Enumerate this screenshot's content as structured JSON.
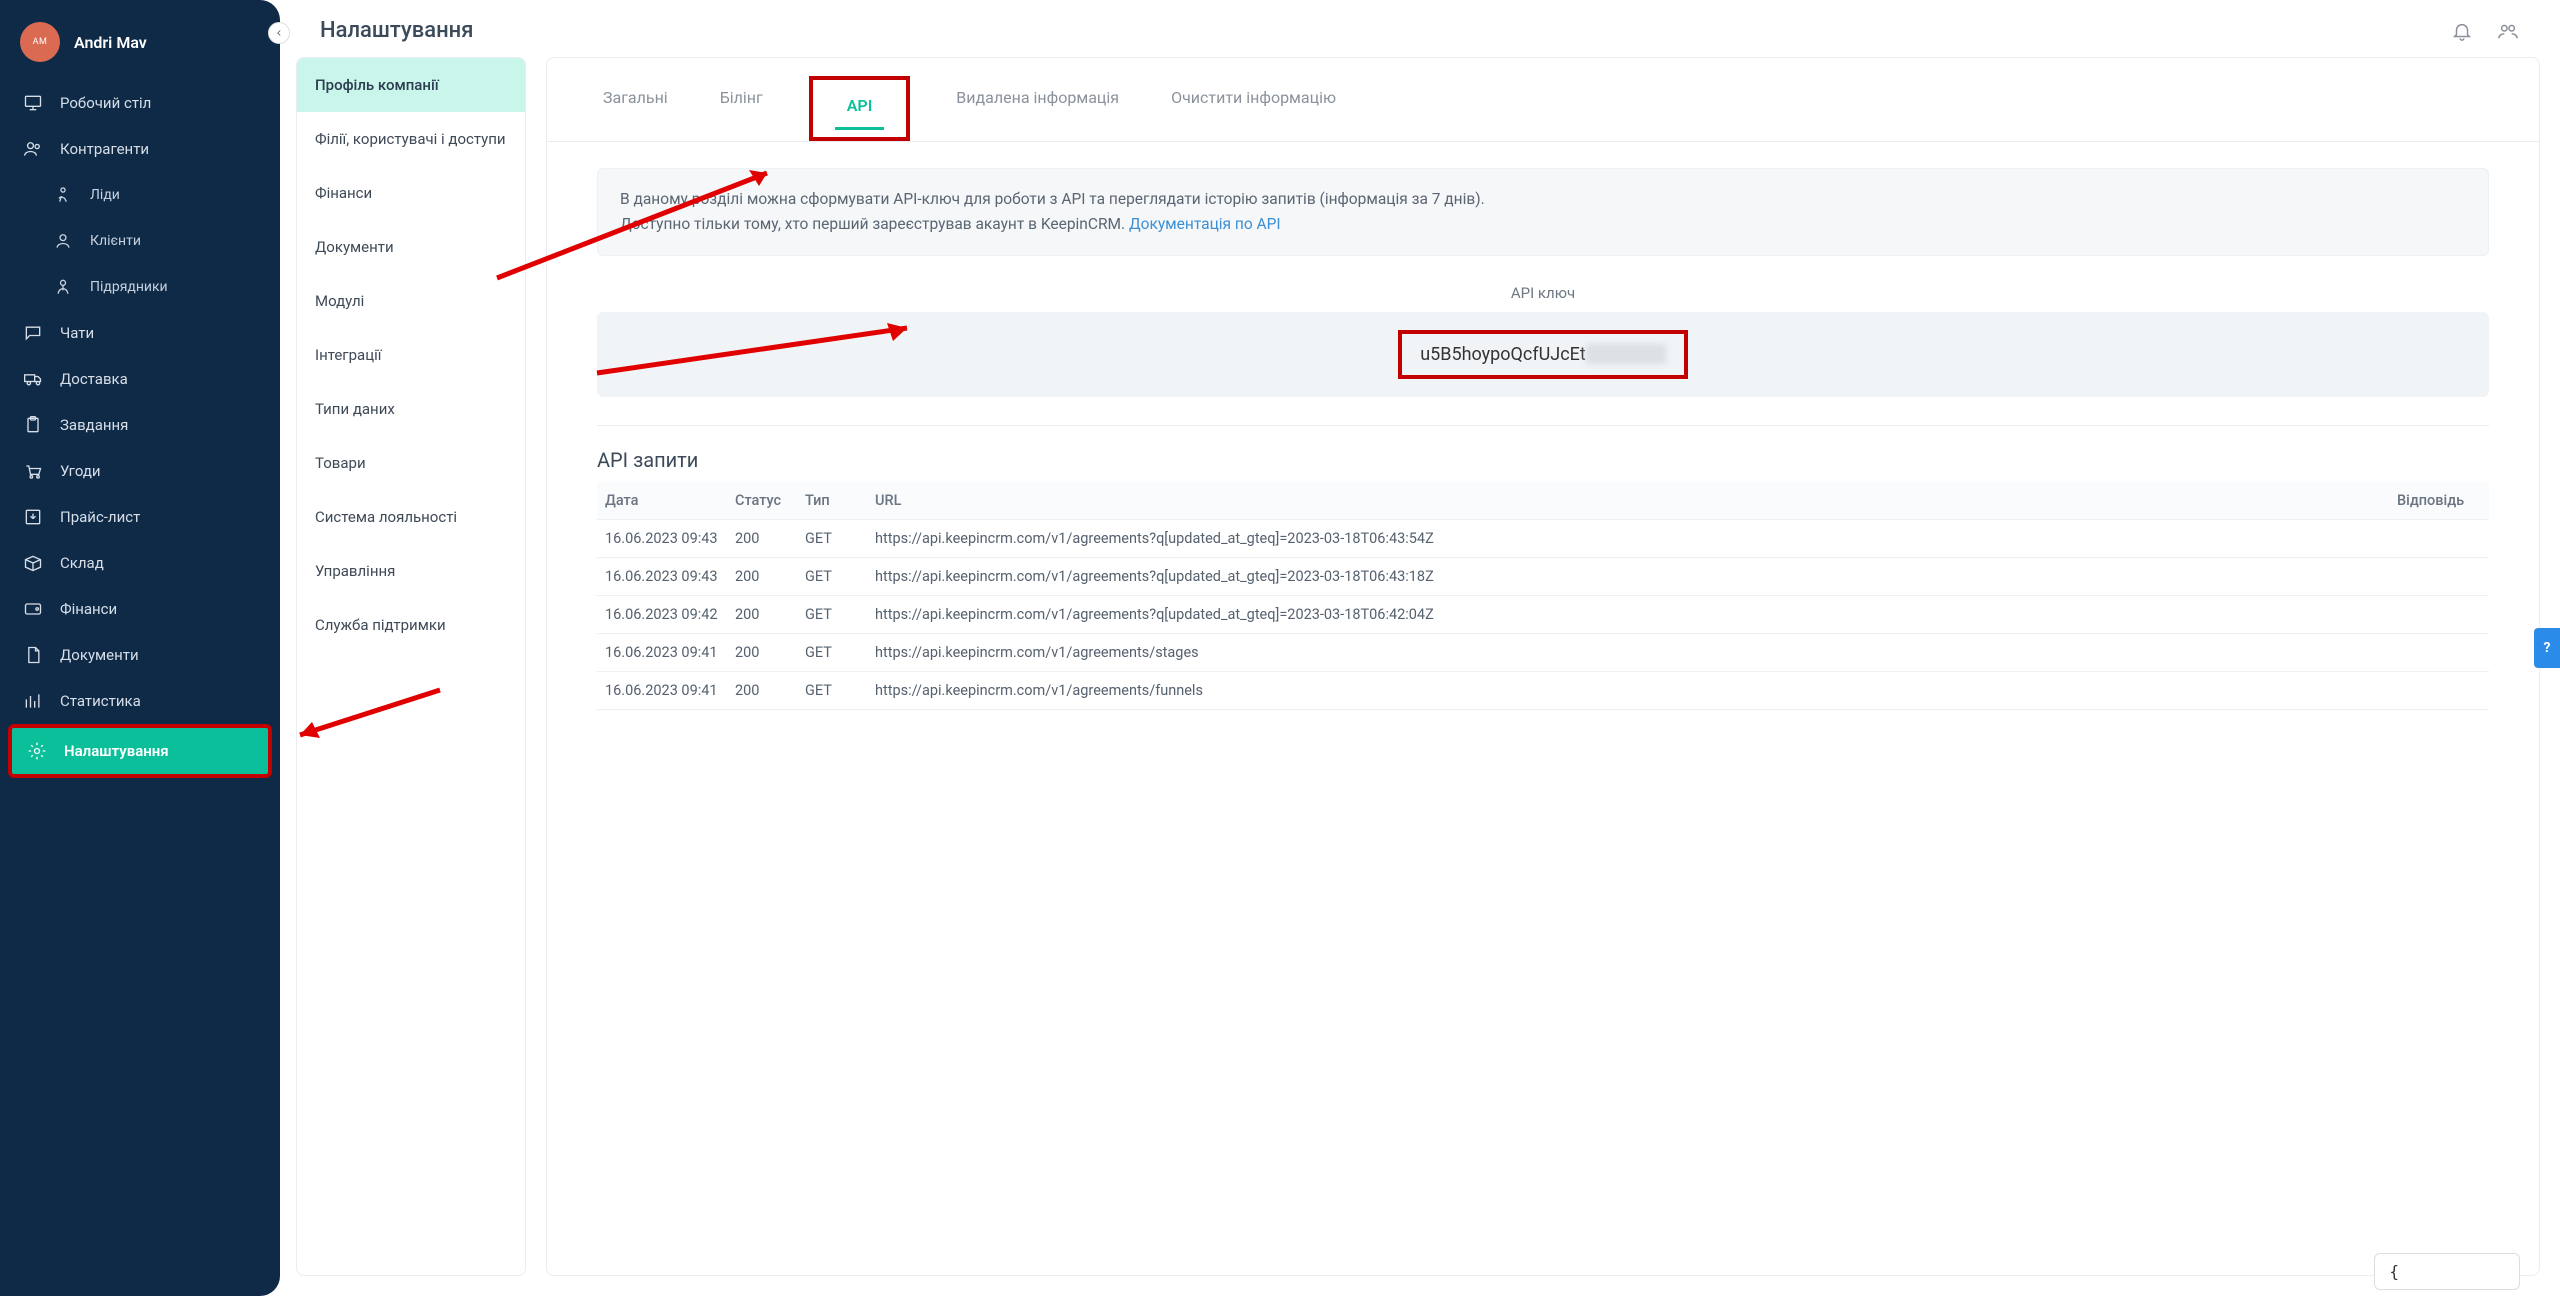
{
  "user": {
    "initials": "AM",
    "name": "Andri Mav"
  },
  "page_title": "Налаштування",
  "sidebar": {
    "items": [
      {
        "label": "Робочий стіл"
      },
      {
        "label": "Контрагенти"
      },
      {
        "label": "Ліди"
      },
      {
        "label": "Клієнти"
      },
      {
        "label": "Підрядники"
      },
      {
        "label": "Чати"
      },
      {
        "label": "Доставка"
      },
      {
        "label": "Завдання"
      },
      {
        "label": "Угоди"
      },
      {
        "label": "Прайс-лист"
      },
      {
        "label": "Склад"
      },
      {
        "label": "Фінанси"
      },
      {
        "label": "Документи"
      },
      {
        "label": "Статистика"
      },
      {
        "label": "Налаштування"
      }
    ]
  },
  "settings_menu": [
    "Профіль компанії",
    "Філії, користувачі і доступи",
    "Фінанси",
    "Документи",
    "Модулі",
    "Інтеграції",
    "Типи даних",
    "Товари",
    "Система лояльності",
    "Управління",
    "Служба підтримки"
  ],
  "tabs": [
    "Загальні",
    "Білінг",
    "API",
    "Видалена інформація",
    "Очистити інформацію"
  ],
  "info": {
    "line1": "В даному розділі можна сформувати API-ключ для роботи з API та переглядати історію запитів (інформація за 7 днів).",
    "line2_prefix": "Доступно тільки тому, хто перший зареєстрував акаунт в KeepinCRM. ",
    "link_text": "Документація по API"
  },
  "api_key": {
    "label": "API ключ",
    "value": "u5B5hoypoQcfUJcEt"
  },
  "requests": {
    "title": "API запити",
    "headers": {
      "date": "Дата",
      "status": "Статус",
      "type": "Тип",
      "url": "URL",
      "response": "Відповідь"
    },
    "rows": [
      {
        "date": "16.06.2023 09:43",
        "status": "200",
        "type": "GET",
        "url": "https://api.keepincrm.com/v1/agreements?q[updated_at_gteq]=2023-03-18T06:43:54Z"
      },
      {
        "date": "16.06.2023 09:43",
        "status": "200",
        "type": "GET",
        "url": "https://api.keepincrm.com/v1/agreements?q[updated_at_gteq]=2023-03-18T06:43:18Z"
      },
      {
        "date": "16.06.2023 09:42",
        "status": "200",
        "type": "GET",
        "url": "https://api.keepincrm.com/v1/agreements?q[updated_at_gteq]=2023-03-18T06:42:04Z"
      },
      {
        "date": "16.06.2023 09:41",
        "status": "200",
        "type": "GET",
        "url": "https://api.keepincrm.com/v1/agreements/stages"
      },
      {
        "date": "16.06.2023 09:41",
        "status": "200",
        "type": "GET",
        "url": "https://api.keepincrm.com/v1/agreements/funnels"
      }
    ]
  },
  "help_label": "?",
  "bottom_chip": "{"
}
